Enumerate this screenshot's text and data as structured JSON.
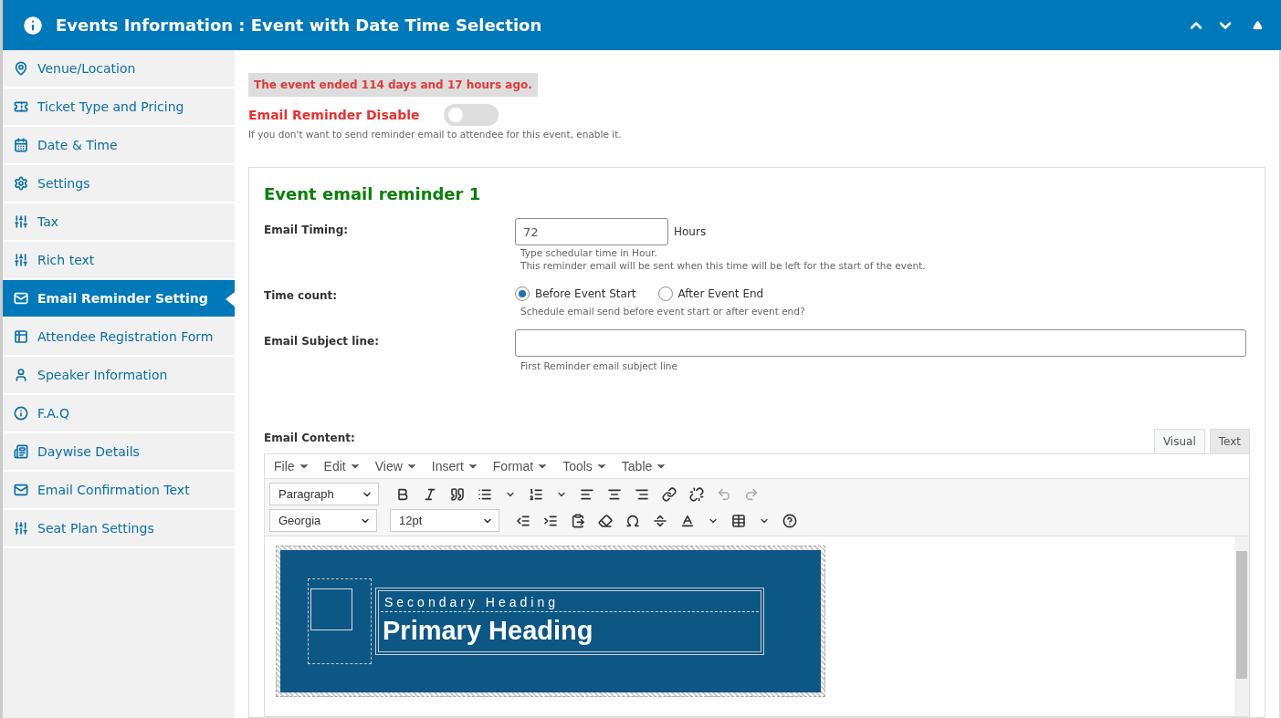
{
  "header": {
    "title": "Events Information : Event with Date Time Selection"
  },
  "sidebar": {
    "items": [
      {
        "label": "Venue/Location",
        "selected": false
      },
      {
        "label": "Ticket Type and Pricing",
        "selected": false
      },
      {
        "label": "Date & Time",
        "selected": false
      },
      {
        "label": "Settings",
        "selected": false
      },
      {
        "label": "Tax",
        "selected": false
      },
      {
        "label": "Rich text",
        "selected": false
      },
      {
        "label": "Email Reminder Setting",
        "selected": true
      },
      {
        "label": "Attendee Registration Form",
        "selected": false
      },
      {
        "label": "Speaker Information",
        "selected": false
      },
      {
        "label": "F.A.Q",
        "selected": false
      },
      {
        "label": "Daywise Details",
        "selected": false
      },
      {
        "label": "Email Confirmation Text",
        "selected": false
      },
      {
        "label": "Seat Plan Settings",
        "selected": false
      }
    ]
  },
  "notice": "The event ended 114 days and 17 hours ago.",
  "reminder_toggle": {
    "label": "Email Reminder Disable",
    "on": false,
    "hint": "If you don't want to send reminder email to attendee for this event, enable it."
  },
  "reminder": {
    "title": "Event email reminder 1",
    "email_timing": {
      "label": "Email Timing:",
      "value": "72",
      "unit": "Hours",
      "hints": [
        "Type schedular time in Hour.",
        "This reminder email will be sent when this time will be left for the start of the event."
      ]
    },
    "time_count": {
      "label": "Time count:",
      "options": [
        {
          "label": "Before Event Start",
          "selected": true
        },
        {
          "label": "After Event End",
          "selected": false
        }
      ],
      "hint": "Schedule email send before event start or after event end?"
    },
    "subject": {
      "label": "Email Subject line:",
      "hint": "First Reminder email subject line"
    },
    "content": {
      "label": "Email Content:",
      "tabs": [
        {
          "label": "Visual",
          "selected": true
        },
        {
          "label": "Text",
          "selected": false
        }
      ],
      "menu": [
        "File",
        "Edit",
        "View",
        "Insert",
        "Format",
        "Tools",
        "Table"
      ],
      "block_format": "Paragraph",
      "font": "Georgia",
      "font_size": "12pt",
      "preview": {
        "secondary_heading": "Secondary Heading",
        "primary_heading": "Primary Heading"
      }
    }
  }
}
